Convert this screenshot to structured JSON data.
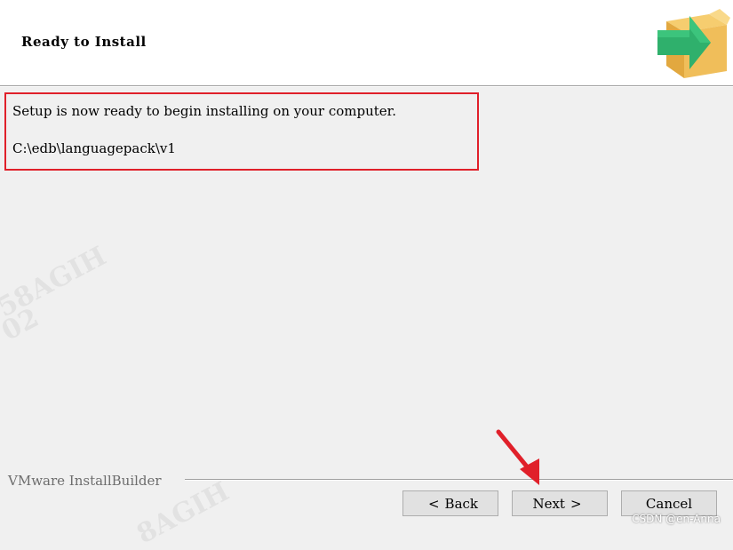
{
  "header": {
    "title": "Ready to Install",
    "icon": "install-box-arrow-icon"
  },
  "main": {
    "message": "Setup is now ready to begin installing on your computer.",
    "install_path": "C:\\edb\\languagepack\\v1",
    "highlight_color": "#e0202a"
  },
  "footer": {
    "brand": "VMware InstallBuilder",
    "buttons": {
      "back": {
        "glyph": "<",
        "label": "Back"
      },
      "next": {
        "label": "Next",
        "glyph": ">"
      },
      "cancel": {
        "label": "Cancel"
      }
    }
  },
  "annotations": {
    "pointer_arrow_color": "#e0202a",
    "credit": "CSDN @en-Anna"
  },
  "watermarks": [
    "58AGIH",
    "02",
    "8AGIH"
  ]
}
